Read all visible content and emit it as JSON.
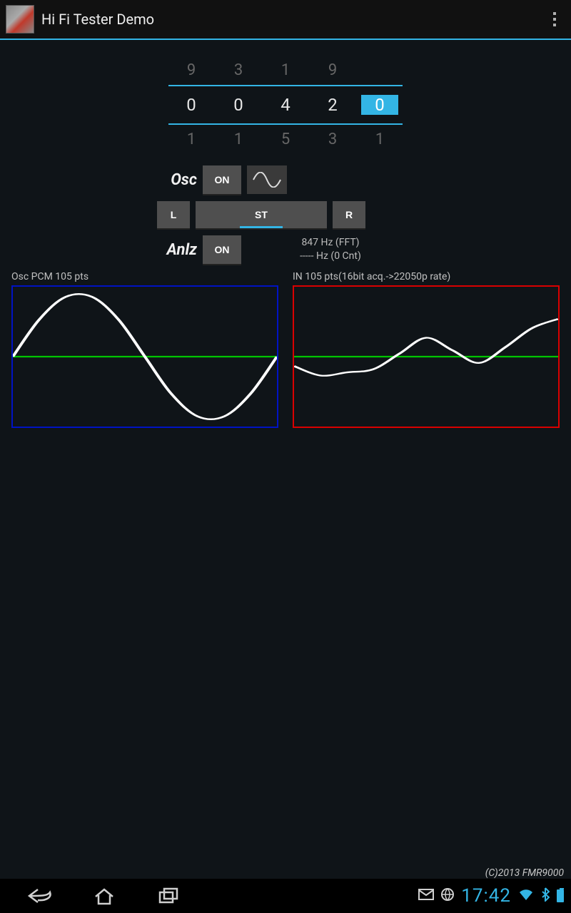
{
  "header": {
    "title": "Hi Fi Tester Demo"
  },
  "picker": {
    "above": [
      "9",
      "3",
      "1",
      "9",
      ""
    ],
    "value": [
      "0",
      "0",
      "4",
      "2",
      "0"
    ],
    "below": [
      "1",
      "1",
      "5",
      "3",
      "1"
    ],
    "cursor_index": 4
  },
  "osc": {
    "label": "Osc",
    "on_label": "ON"
  },
  "channels": {
    "left": "L",
    "stereo": "ST",
    "right": "R"
  },
  "anlz": {
    "label": "Anlz",
    "on_label": "ON",
    "fft_line": "847 Hz (FFT)",
    "cnt_line": "----- Hz (0 Cnt)"
  },
  "scopes": {
    "left_label": "Osc PCM 105 pts",
    "right_label": "IN 105 pts(16bit acq.->22050p rate)"
  },
  "chart_data": [
    {
      "type": "line",
      "title": "Osc PCM 105 pts",
      "x": [
        0,
        10,
        20,
        30,
        40,
        50,
        60,
        70,
        80,
        90,
        100
      ],
      "values": [
        0,
        0.59,
        0.95,
        0.95,
        0.59,
        0,
        -0.59,
        -0.95,
        -0.95,
        -0.59,
        0
      ],
      "ylim": [
        -1,
        1
      ]
    },
    {
      "type": "line",
      "title": "IN 105 pts(16bit acq.->22050p rate)",
      "x": [
        0,
        10,
        20,
        30,
        40,
        50,
        60,
        70,
        80,
        90,
        100
      ],
      "values": [
        -0.15,
        -0.3,
        -0.25,
        -0.2,
        0.05,
        0.3,
        0.1,
        -0.1,
        0.15,
        0.45,
        0.6
      ],
      "ylim": [
        -1,
        1
      ]
    }
  ],
  "copyright": "(C)2013 FMR9000",
  "statusbar": {
    "time": "17:42"
  }
}
